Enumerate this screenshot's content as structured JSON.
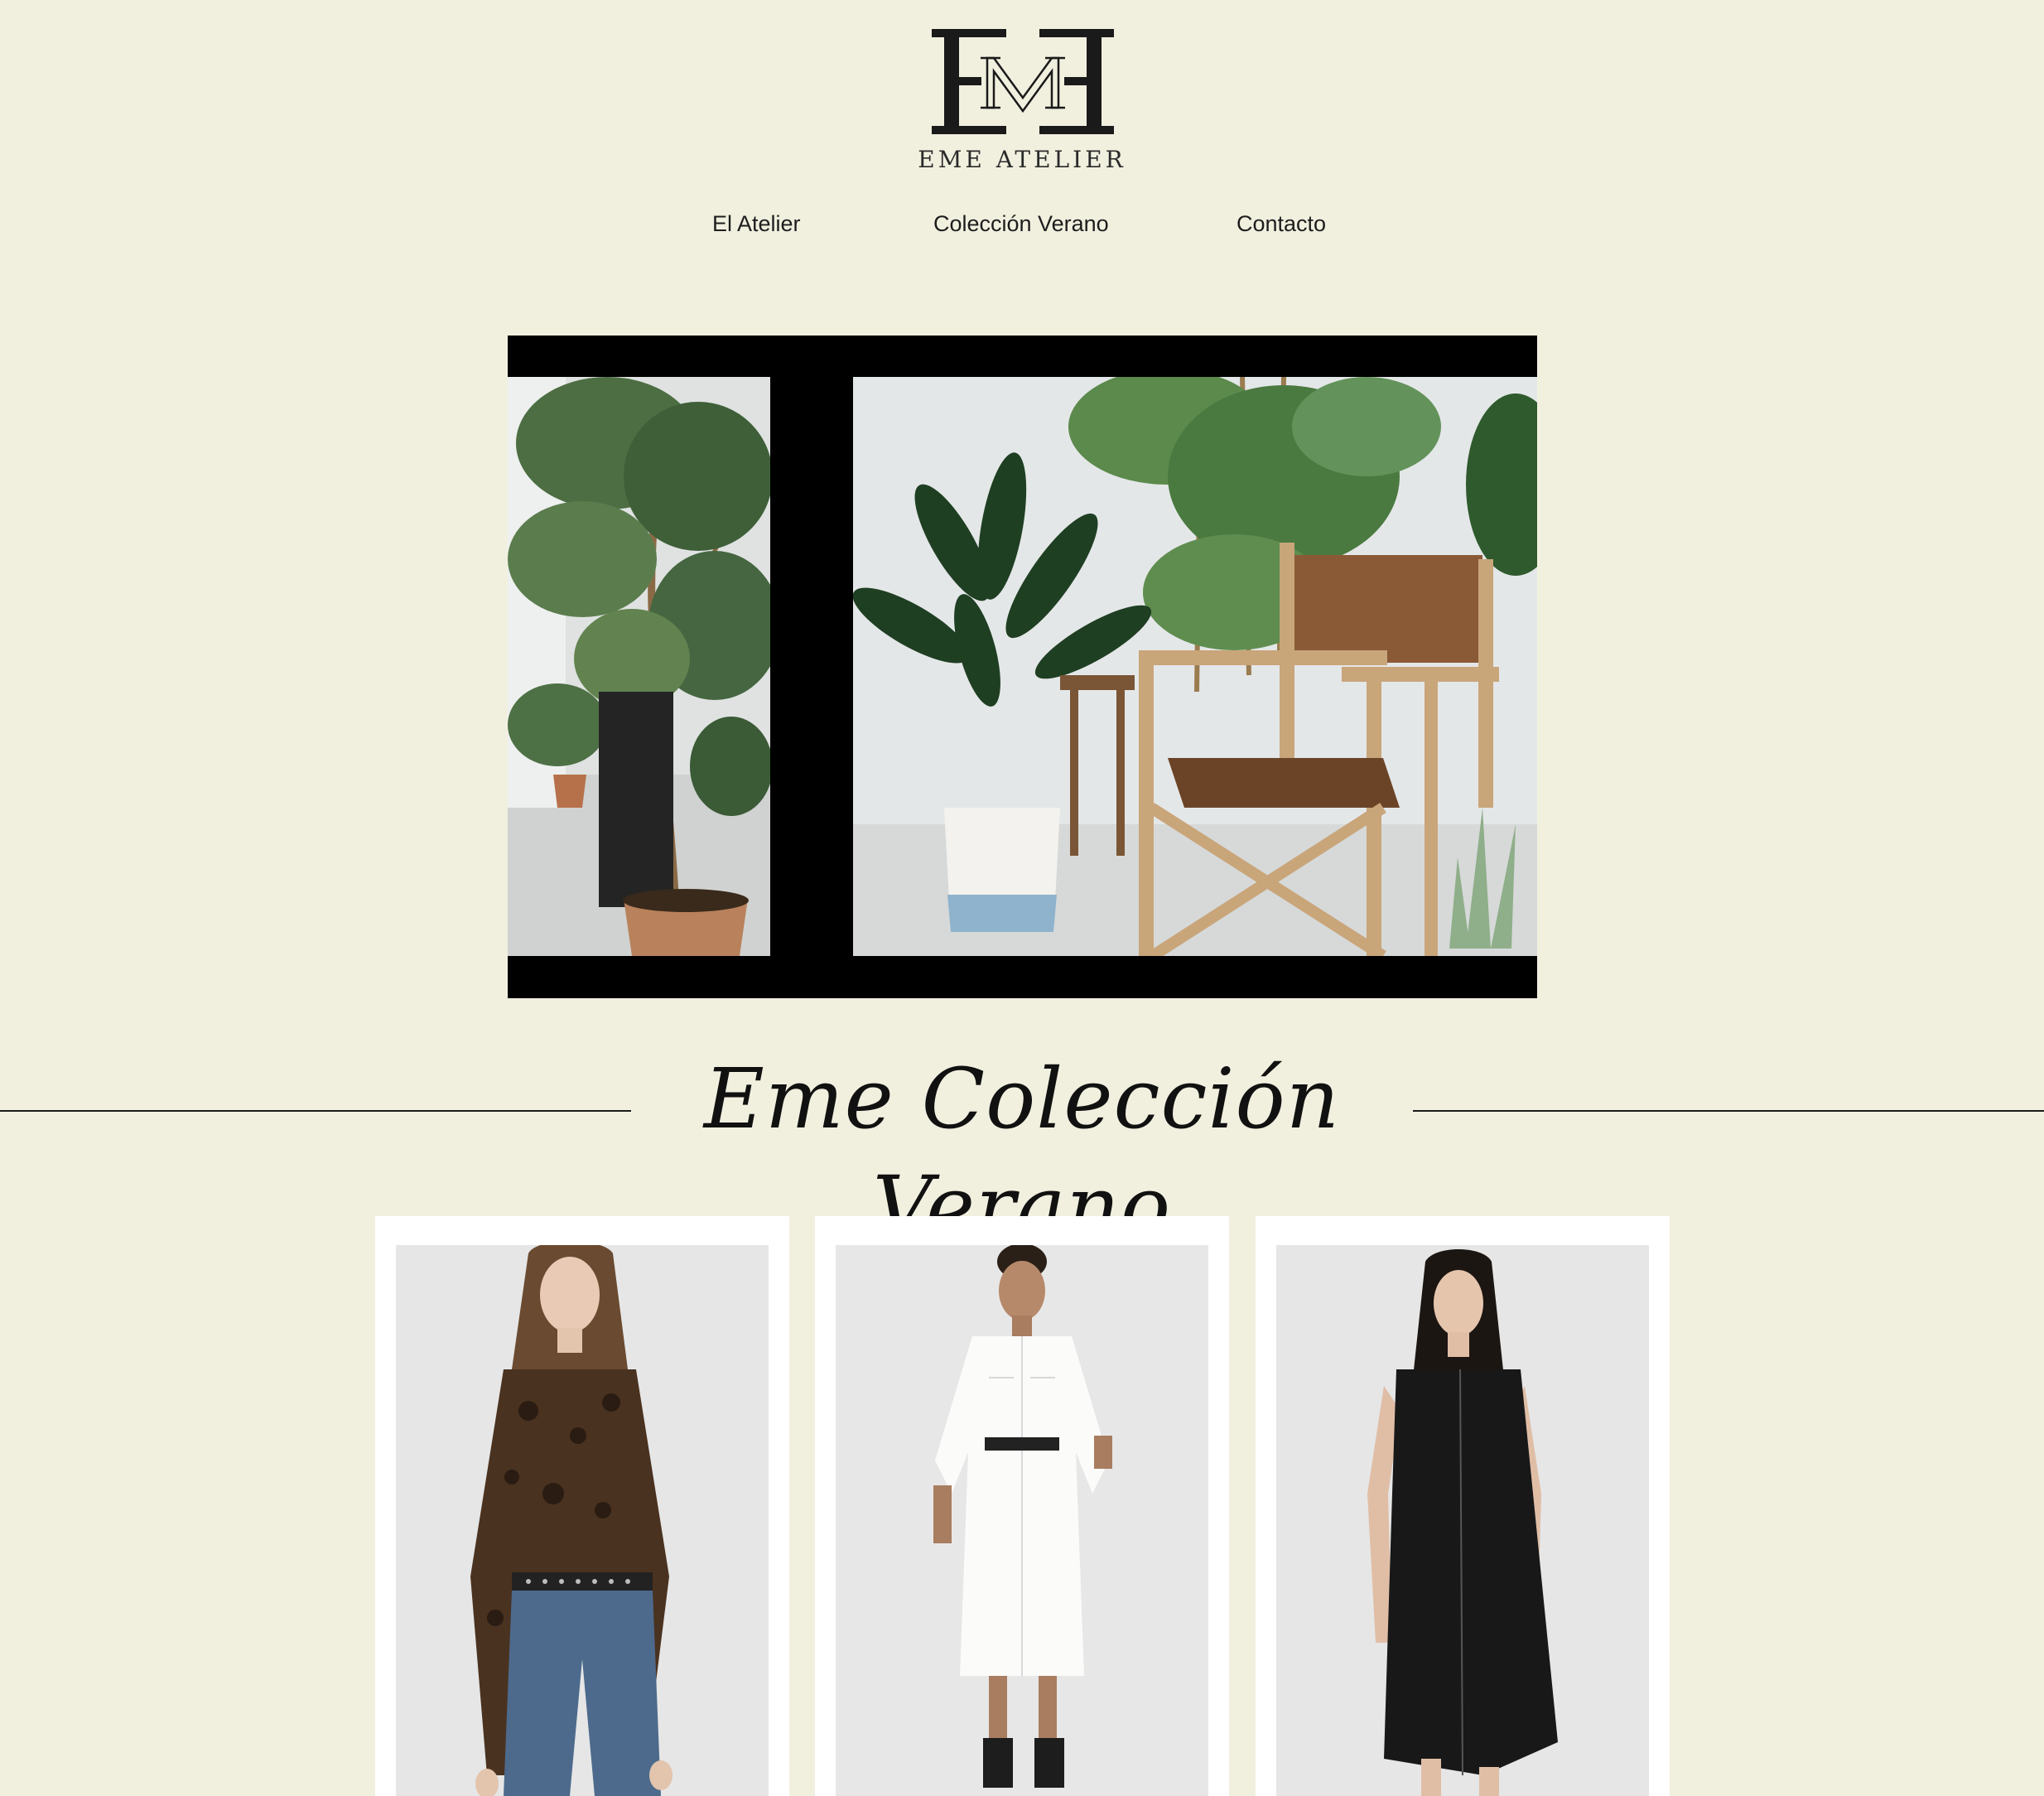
{
  "header": {
    "logo_monogram": "EME",
    "brand_name": "EME ATELIER"
  },
  "nav": {
    "items": [
      {
        "label": "El Atelier"
      },
      {
        "label": "Colección Verano"
      },
      {
        "label": "Contacto"
      }
    ]
  },
  "hero": {
    "frame_color": "#000000"
  },
  "section": {
    "title": "Eme Colección Verano"
  },
  "products": [
    {
      "image": "model-leopard-top-jeans"
    },
    {
      "image": "model-white-shirt-dress"
    },
    {
      "image": "model-black-sleeveless-dress"
    }
  ],
  "colors": {
    "background": "#f1f0df",
    "text": "#1d1d1d",
    "card": "#ffffff"
  }
}
